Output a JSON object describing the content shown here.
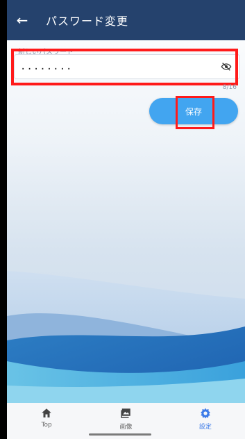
{
  "appbar": {
    "back_icon": "arrow-left-icon",
    "title": "パスワード変更"
  },
  "password": {
    "label": "新しいパスワード",
    "value": "........",
    "counter": "8/16",
    "visibility_icon": "eye-off-icon"
  },
  "actions": {
    "save_label": "保存"
  },
  "bottom_nav": {
    "items": [
      {
        "label": "Top",
        "icon": "home-icon"
      },
      {
        "label": "画像",
        "icon": "image-icon"
      },
      {
        "label": "設定",
        "icon": "gear-icon"
      }
    ],
    "active_index": 2
  },
  "colors": {
    "appbar": "#25426d",
    "accent": "#42a5f0",
    "active_nav": "#3d7be8",
    "highlight": "#ff1a1a"
  }
}
